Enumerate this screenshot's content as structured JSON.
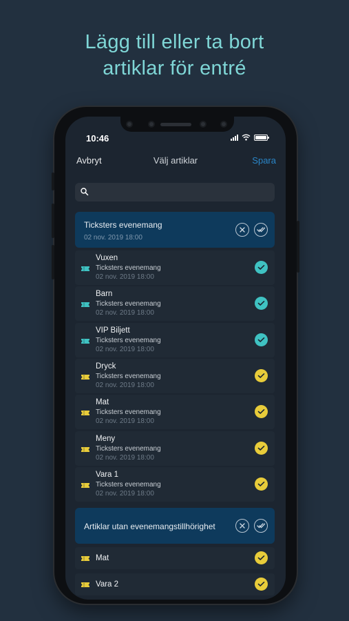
{
  "headline": {
    "line1": "Lägg till eller ta bort",
    "line2": "artiklar för entré"
  },
  "status": {
    "time": "10:46"
  },
  "nav": {
    "cancel": "Avbryt",
    "title": "Välj artiklar",
    "save": "Spara"
  },
  "search": {
    "value": ""
  },
  "groups": [
    {
      "title": "Ticksters evenemang",
      "subtitle": "02 nov. 2019 18:00",
      "items": [
        {
          "name": "Vuxen",
          "event": "Ticksters evenemang",
          "date": "02 nov. 2019 18:00",
          "type": "ticket",
          "color": "#3fc2c2"
        },
        {
          "name": "Barn",
          "event": "Ticksters evenemang",
          "date": "02 nov. 2019 18:00",
          "type": "ticket",
          "color": "#3fc2c2"
        },
        {
          "name": "VIP Biljett",
          "event": "Ticksters evenemang",
          "date": "02 nov. 2019 18:00",
          "type": "ticket",
          "color": "#3fc2c2"
        },
        {
          "name": "Dryck",
          "event": "Ticksters evenemang",
          "date": "02 nov. 2019 18:00",
          "type": "product",
          "color": "#e8cc3a"
        },
        {
          "name": "Mat",
          "event": "Ticksters evenemang",
          "date": "02 nov. 2019 18:00",
          "type": "product",
          "color": "#e8cc3a"
        },
        {
          "name": "Meny",
          "event": "Ticksters evenemang",
          "date": "02 nov. 2019 18:00",
          "type": "product",
          "color": "#e8cc3a"
        },
        {
          "name": "Vara 1",
          "event": "Ticksters evenemang",
          "date": "02 nov. 2019 18:00",
          "type": "product",
          "color": "#e8cc3a"
        }
      ]
    },
    {
      "title": "Artiklar utan evenemangstillhörighet",
      "items": [
        {
          "name": "Mat",
          "type": "product",
          "color": "#e8cc3a"
        },
        {
          "name": "Vara 2",
          "type": "product",
          "color": "#e8cc3a"
        }
      ]
    }
  ]
}
